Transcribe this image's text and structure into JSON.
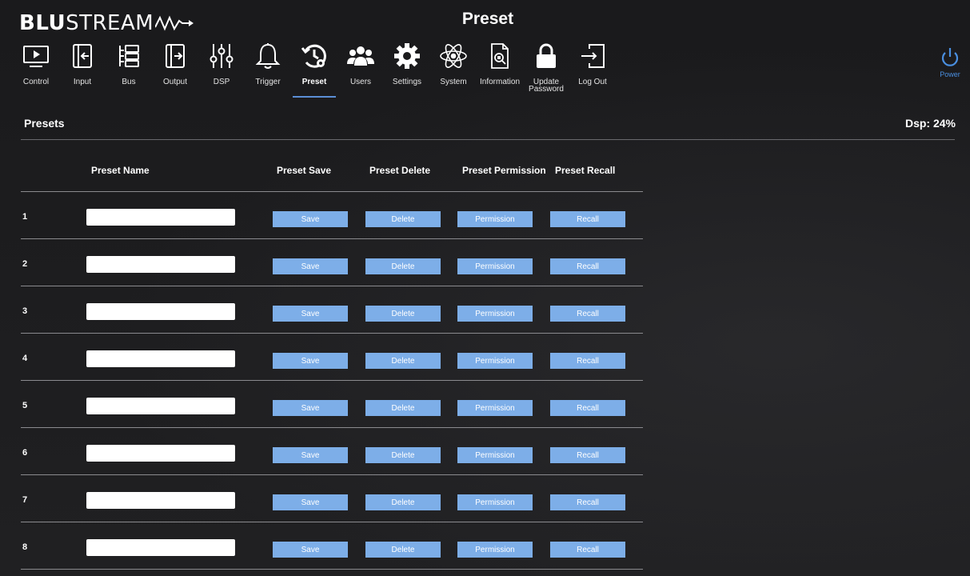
{
  "brand": {
    "bold": "BLU",
    "rest": "STREAM"
  },
  "page_title": "Preset",
  "nav": [
    {
      "id": "control",
      "label": "Control",
      "icon": "monitor-play-icon"
    },
    {
      "id": "input",
      "label": "Input",
      "icon": "input-arrow-icon"
    },
    {
      "id": "bus",
      "label": "Bus",
      "icon": "bus-icon"
    },
    {
      "id": "output",
      "label": "Output",
      "icon": "output-arrow-icon"
    },
    {
      "id": "dsp",
      "label": "DSP",
      "icon": "sliders-icon"
    },
    {
      "id": "trigger",
      "label": "Trigger",
      "icon": "bell-icon"
    },
    {
      "id": "preset",
      "label": "Preset",
      "icon": "preset-clock-gear-icon",
      "active": true
    },
    {
      "id": "users",
      "label": "Users",
      "icon": "users-icon"
    },
    {
      "id": "settings",
      "label": "Settings",
      "icon": "gear-icon"
    },
    {
      "id": "system",
      "label": "System",
      "icon": "atom-icon"
    },
    {
      "id": "information",
      "label": "Information",
      "icon": "document-search-icon"
    },
    {
      "id": "update-password",
      "label": "Update Password",
      "icon": "lock-icon"
    },
    {
      "id": "logout",
      "label": "Log Out",
      "icon": "logout-icon"
    }
  ],
  "power": {
    "label": "Power",
    "color": "#4a8fe0"
  },
  "section": {
    "title": "Presets",
    "dsp": "Dsp: 24%"
  },
  "columns": {
    "name": "Preset Name",
    "save": "Preset Save",
    "delete": "Preset Delete",
    "permission": "Preset Permission",
    "recall": "Preset Recall"
  },
  "buttons": {
    "save": "Save",
    "delete": "Delete",
    "permission": "Permission",
    "recall": "Recall"
  },
  "rows": [
    {
      "num": "1",
      "name": ""
    },
    {
      "num": "2",
      "name": ""
    },
    {
      "num": "3",
      "name": ""
    },
    {
      "num": "4",
      "name": ""
    },
    {
      "num": "5",
      "name": ""
    },
    {
      "num": "6",
      "name": ""
    },
    {
      "num": "7",
      "name": ""
    },
    {
      "num": "8",
      "name": ""
    }
  ],
  "colors": {
    "button": "#7daee8",
    "accent": "#5b8fd6",
    "background": "#1b1b1d"
  }
}
